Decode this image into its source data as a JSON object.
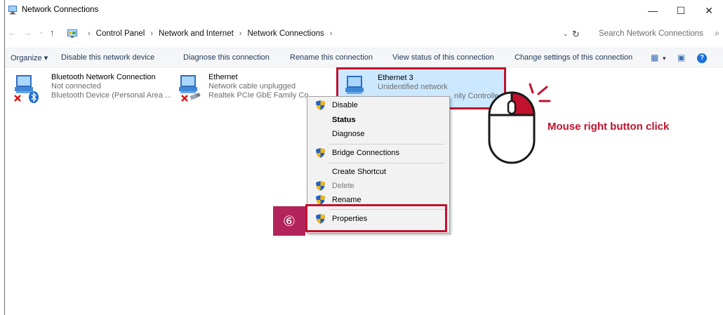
{
  "window": {
    "title": "Network Connections",
    "controls": {
      "minimize": "—",
      "maximize": "☐",
      "close": "✕"
    }
  },
  "address": {
    "breadcrumbs": [
      "Control Panel",
      "Network and Internet",
      "Network Connections"
    ],
    "separator": "›",
    "search_placeholder": "Search Network Connections"
  },
  "commands": {
    "organize": "Organize ▾",
    "disable": "Disable this network device",
    "diagnose": "Diagnose this connection",
    "rename": "Rename this connection",
    "view_status": "View status of this connection",
    "change_settings": "Change settings of this connection"
  },
  "connections": [
    {
      "name": "Bluetooth Network Connection",
      "status": "Not connected",
      "device": "Bluetooth Device (Personal Area ..."
    },
    {
      "name": "Ethernet",
      "status": "Network cable unplugged",
      "device": "Realtek PCIe GbE Family Co"
    },
    {
      "name": "Ethernet 3",
      "status": "Unidentified network",
      "device": "nily Controlle"
    }
  ],
  "context_menu": [
    {
      "label": "Disable",
      "icon": "shield-icon",
      "style": "normal"
    },
    {
      "label": "Status",
      "icon": "",
      "style": "bold"
    },
    {
      "label": "Diagnose",
      "icon": "",
      "style": "normal"
    },
    {
      "label": "Bridge Connections",
      "icon": "shield-icon",
      "style": "normal"
    },
    {
      "label": "Create Shortcut",
      "icon": "",
      "style": "normal"
    },
    {
      "label": "Delete",
      "icon": "shield-icon",
      "style": "disabled"
    },
    {
      "label": "Rename",
      "icon": "shield-icon",
      "style": "normal"
    },
    {
      "label": "Properties",
      "icon": "shield-icon",
      "style": "normal"
    }
  ],
  "annotation": {
    "step": "⑥",
    "mouse_text": "Mouse right button click",
    "accent_color": "#c1122e",
    "badge_color": "#b3245b"
  }
}
